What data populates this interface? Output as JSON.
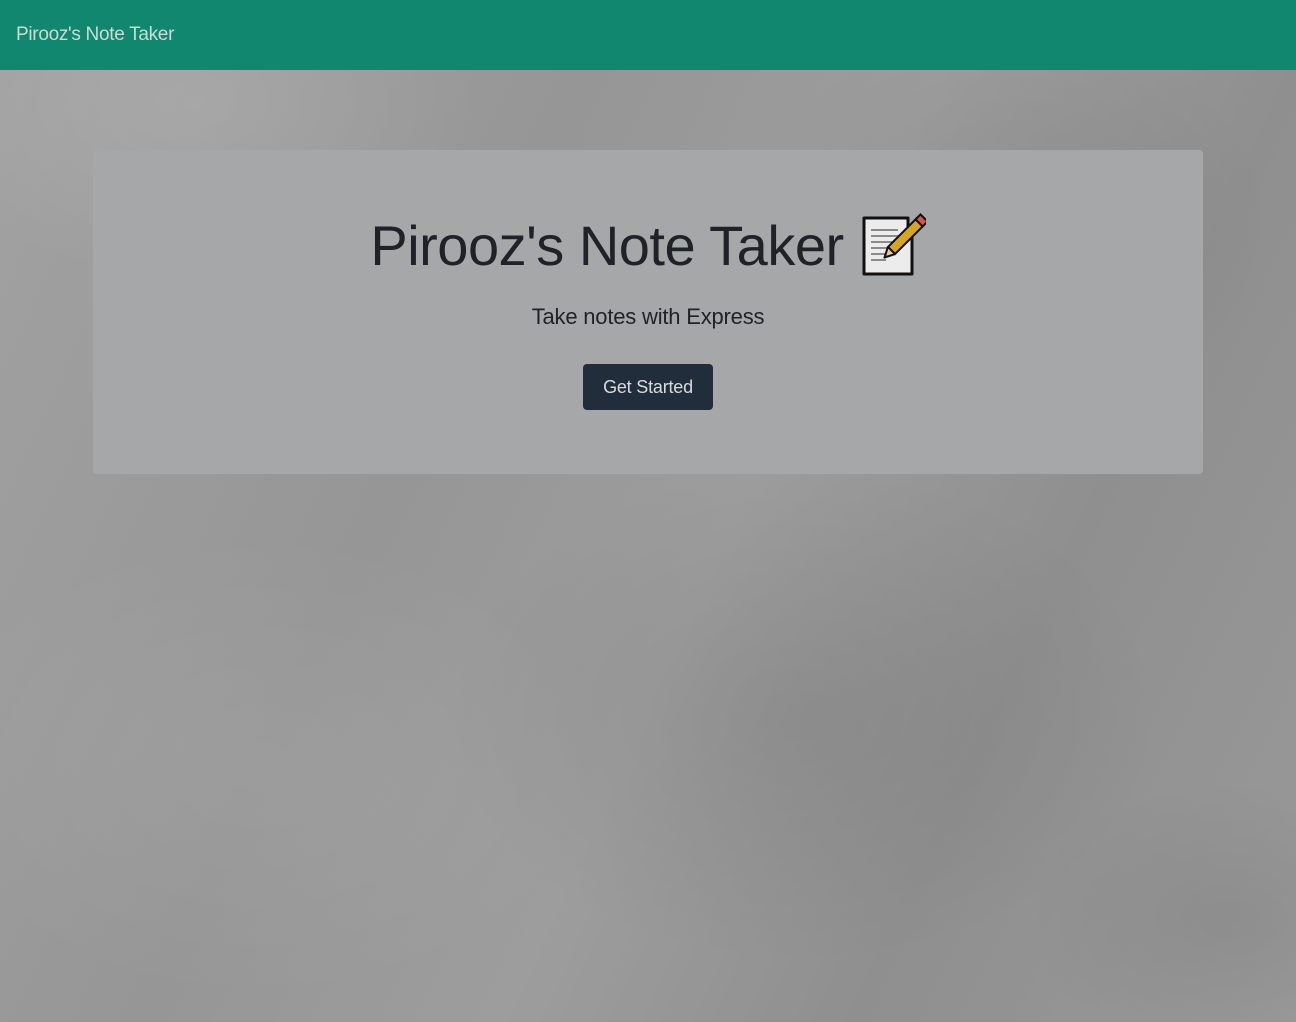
{
  "navbar": {
    "brand": "Pirooz's Note Taker"
  },
  "hero": {
    "title": "Pirooz's Note Taker",
    "title_icon": "memo-icon",
    "subtitle": "Take notes with Express",
    "cta_label": "Get Started"
  },
  "colors": {
    "navbar_bg": "#11876f",
    "card_bg": "#a6a7a9",
    "button_bg": "#222d3c"
  }
}
